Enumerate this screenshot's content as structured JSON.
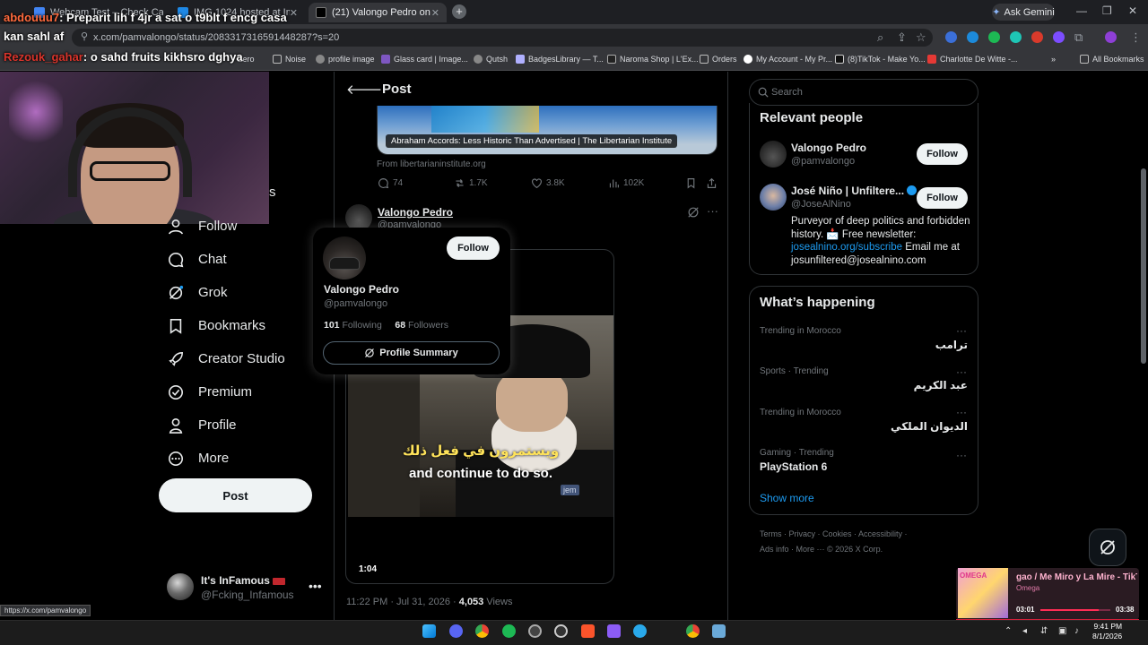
{
  "browser": {
    "tabs": [
      {
        "label": "Webcam Test – Check Cam"
      },
      {
        "label": "IMG 1024 hosted at ImgBB –"
      },
      {
        "label": "(21) Valongo Pedro on X: \"@Jo"
      }
    ],
    "new_tab": "+",
    "ask_gemini": "Ask Gemini",
    "url": "x.com/pamvalongo/status/2083317316591448287?s=20",
    "bookmarks": [
      "Zero",
      "Noise",
      "profile image",
      "Glass card | Image...",
      "Qutsh",
      "BadgesLibrary — T...",
      "Naroma Shop | L'Ex...",
      "Orders",
      "My Account - My Pr...",
      "(8)TikTok - Make Yo...",
      "Charlotte De Witte -..."
    ],
    "all_bookmarks": "All Bookmarks",
    "status_url": "https://x.com/pamvalongo"
  },
  "stream_overlay": {
    "line1_user": "abdouuu7",
    "line1_text": ": Preparit lih f 4jr a sat o t9blt f encg casa",
    "line2_text": "kan sahl af",
    "line3_user": "Rezouk_gahar",
    "line3_text": ": o sahd fruits kikhsro dghya",
    "partial_s": "s"
  },
  "left_nav": {
    "items": [
      {
        "label": "Follow"
      },
      {
        "label": "Chat"
      },
      {
        "label": "Grok"
      },
      {
        "label": "Bookmarks"
      },
      {
        "label": "Creator Studio"
      },
      {
        "label": "Premium"
      },
      {
        "label": "Profile"
      },
      {
        "label": "More"
      }
    ],
    "post_button": "Post",
    "account": {
      "name": "It's InFamous",
      "handle": "@Fcking_Infamous"
    }
  },
  "main": {
    "header_title": "Post",
    "link_card": {
      "title": "Abraham Accords: Less Historic Than Advertised | The Libertarian Institute",
      "source": "From libertarianinstitute.org"
    },
    "actions": {
      "replies": "74",
      "reposts": "1.7K",
      "likes": "3.8K",
      "views": "102K"
    },
    "tweet": {
      "name": "Valongo Pedro",
      "handle": "@pamvalongo",
      "video_subtitle_ar": "ويستمرون في فعل ذلك",
      "video_subtitle_en": "and continue to do so.",
      "video_logo": "jem",
      "video_time": "1:04",
      "timestamp": "11:22 PM · Jul 31, 2026 · ",
      "views_count": "4,053",
      "views_label": " Views"
    },
    "hovercard": {
      "follow": "Follow",
      "name": "Valongo Pedro",
      "handle": "@pamvalongo",
      "following_count": "101",
      "following_label": " Following",
      "followers_count": "68",
      "followers_label": " Followers",
      "profile_summary": "Profile Summary"
    }
  },
  "right": {
    "search_placeholder": "Search",
    "relevant_title": "Relevant people",
    "people": [
      {
        "name": "Valongo Pedro",
        "handle": "@pamvalongo",
        "follow": "Follow"
      },
      {
        "name": "José Niño | Unfiltere...",
        "handle": "@JoseAlNino",
        "follow": "Follow"
      }
    ],
    "bio": {
      "part1": "Purveyor of deep politics and forbidden history. 📩 Free newsletter: ",
      "link": "josealnino.org/subscribe",
      "part2": " Email me at josunfiltered@josealnino.com"
    },
    "happening_title": "What’s happening",
    "trends": [
      {
        "meta": "Trending in Morocco",
        "topic": "ترامب"
      },
      {
        "meta": "Sports · Trending",
        "topic": "عبد الكريم"
      },
      {
        "meta": "Trending in Morocco",
        "topic": "الديوان الملكي"
      },
      {
        "meta": "Gaming · Trending",
        "topic": "PlayStation 6"
      }
    ],
    "show_more": "Show more",
    "footer1": "Terms · Privacy · Cookies · Accessibility ·",
    "footer2": "Ads info · More ··· © 2026 X Corp."
  },
  "now_playing": {
    "art_text": "OMEGA",
    "title": "gao / Me Miro y La Mire - TikT",
    "artist": "Omega",
    "current": "03:01",
    "duration": "03:38",
    "progress": 0.83
  },
  "taskbar": {
    "time": "9:41 PM",
    "date": "8/1/2026"
  },
  "colors": {
    "accent": "#1d9bf0",
    "bg": "#000000",
    "text": "#e7e9ea",
    "muted": "#71767b"
  }
}
